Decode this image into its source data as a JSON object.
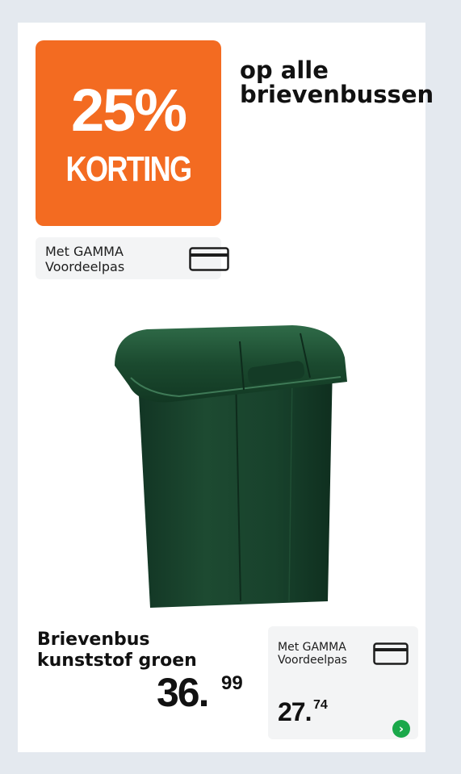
{
  "promo": {
    "percent": "25%",
    "label": "KORTING",
    "bg_color": "#f36b21"
  },
  "headline": {
    "line1": "op alle",
    "line2": "brievenbussen"
  },
  "pass_tag": {
    "line1": "Met GAMMA",
    "line2": "Voordeelpas",
    "icon": "card-icon"
  },
  "product": {
    "name_line1": "Brievenbus",
    "name_line2": "kunststof groen",
    "image_icon": "green-mailbox-image",
    "color": "#1c4a2c"
  },
  "price": {
    "regular_int": "36",
    "regular_dec": "99",
    "pass_int": "27",
    "pass_dec": "74"
  },
  "pass_box": {
    "line1": "Met GAMMA",
    "line2": "Voordeelpas",
    "icon": "card-icon",
    "more_icon": "chevron-right-icon",
    "more_glyph": "›",
    "accent": "#1aa84a"
  }
}
